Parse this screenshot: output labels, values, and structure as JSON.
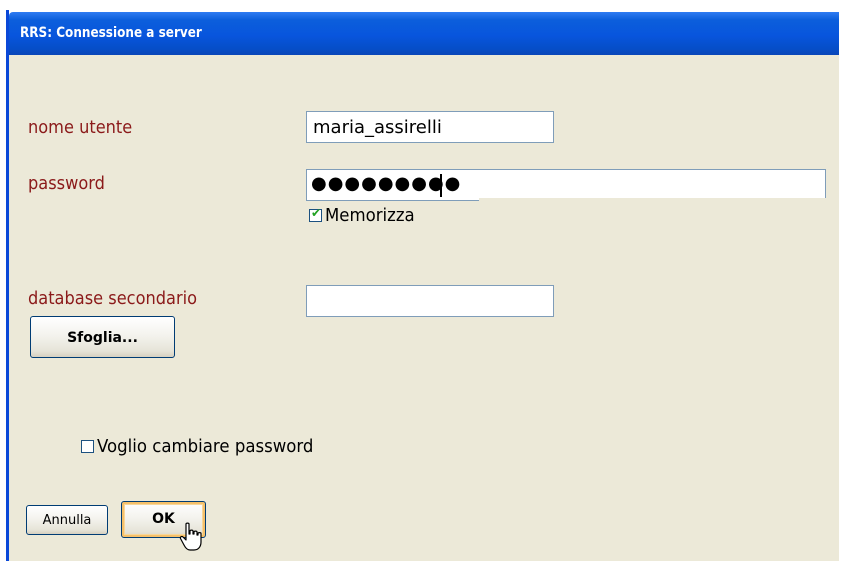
{
  "window": {
    "title": "RRS: Connessione a server"
  },
  "form": {
    "username_label": "nome utente",
    "username_value": "maria_assirelli",
    "password_label": "password",
    "password_mask": "●●●●●●●●●",
    "remember_label": "Memorizza",
    "remember_checked": true,
    "secondary_db_label": "database secondario",
    "secondary_db_value": "",
    "browse_label": "Sfoglia...",
    "change_password_label": "Voglio cambiare password",
    "change_password_checked": false
  },
  "buttons": {
    "cancel_label": "Annulla",
    "ok_label": "OK"
  },
  "icons": {
    "checkmark": "check-icon",
    "cursor": "hand-pointer-icon"
  },
  "colors": {
    "titlebar": "#0855dd",
    "panel": "#ece9d8",
    "label": "#8b1a1a",
    "check": "#21a121"
  }
}
